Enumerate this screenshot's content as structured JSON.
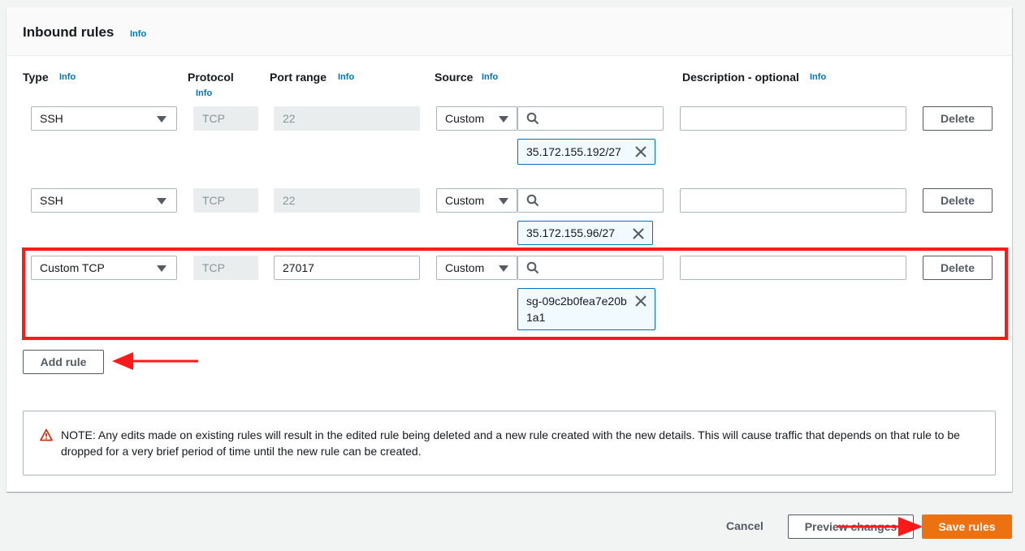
{
  "header": {
    "title": "Inbound rules",
    "info": "Info"
  },
  "columns": {
    "type": "Type",
    "protocol": "Protocol",
    "port_range": "Port range",
    "source": "Source",
    "description": "Description - optional",
    "info": "Info"
  },
  "rules": [
    {
      "type": "SSH",
      "protocol": "TCP",
      "port_range": "22",
      "source_type": "Custom",
      "source_search": "",
      "source_token": "35.172.155.192/27",
      "description": "",
      "delete_label": "Delete"
    },
    {
      "type": "SSH",
      "protocol": "TCP",
      "port_range": "22",
      "source_type": "Custom",
      "source_search": "",
      "source_token": "35.172.155.96/27",
      "description": "",
      "delete_label": "Delete"
    },
    {
      "type": "Custom TCP",
      "protocol": "TCP",
      "port_range": "27017",
      "source_type": "Custom",
      "source_search": "",
      "source_token": "sg-09c2b0fea7e20b1a1",
      "description": "",
      "delete_label": "Delete"
    }
  ],
  "add_rule_label": "Add rule",
  "note": {
    "icon": "warning-icon",
    "text": "NOTE: Any edits made on existing rules will result in the edited rule being deleted and a new rule created with the new details. This will cause traffic that depends on that rule to be dropped for a very brief period of time until the new rule can be created."
  },
  "footer": {
    "cancel_label": "Cancel",
    "preview_label": "Preview changes",
    "save_label": "Save rules"
  },
  "colors": {
    "accent": "#0073bb",
    "primary_button": "#ec7211",
    "annotation_red": "#ff1a1a",
    "warning": "#d13212"
  }
}
